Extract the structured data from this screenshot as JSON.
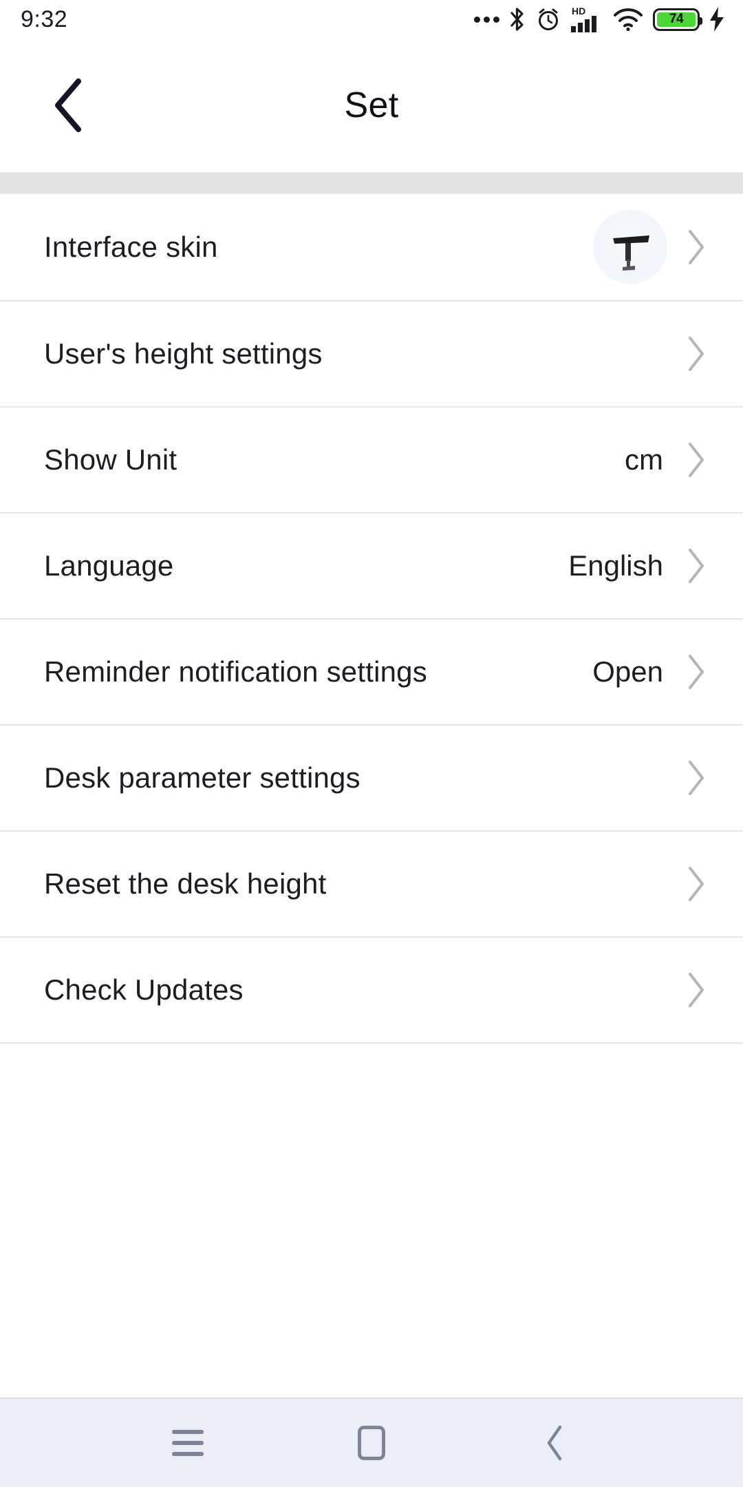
{
  "status_bar": {
    "time": "9:32",
    "icons": [
      {
        "name": "more-dots-icon"
      },
      {
        "name": "bluetooth-icon"
      },
      {
        "name": "alarm-clock-icon"
      },
      {
        "name": "hd-signal-icon",
        "label": "HD"
      },
      {
        "name": "wifi-icon"
      },
      {
        "name": "battery-icon"
      },
      {
        "name": "charging-bolt-icon"
      }
    ],
    "battery_level": "74",
    "battery_color": "#4cd637"
  },
  "header": {
    "title": "Set",
    "back_label": "Back"
  },
  "list": {
    "rows": [
      {
        "label": "Interface skin",
        "value": "",
        "thumbnail": "standing-desk-thumbnail",
        "chevron": "chevron-right-icon"
      },
      {
        "label": "User's height settings",
        "value": "",
        "thumbnail": "",
        "chevron": "chevron-right-icon"
      },
      {
        "label": "Show Unit",
        "value": "cm",
        "thumbnail": "",
        "chevron": "chevron-right-icon"
      },
      {
        "label": "Language",
        "value": "English",
        "thumbnail": "",
        "chevron": "chevron-right-icon"
      },
      {
        "label": "Reminder notification settings",
        "value": "Open",
        "thumbnail": "",
        "chevron": "chevron-right-icon"
      },
      {
        "label": "Desk parameter settings",
        "value": "",
        "thumbnail": "",
        "chevron": "chevron-right-icon"
      },
      {
        "label": "Reset the desk height",
        "value": "",
        "thumbnail": "",
        "chevron": "chevron-right-icon"
      },
      {
        "label": "Check Updates",
        "value": "",
        "thumbnail": "",
        "chevron": "chevron-right-icon"
      }
    ]
  },
  "nav_bar": {
    "buttons": [
      {
        "name": "recents-button",
        "icon": "hamburger-icon"
      },
      {
        "name": "home-button",
        "icon": "home-square-icon"
      },
      {
        "name": "back-button",
        "icon": "chevron-left-icon"
      }
    ],
    "background": "#ebedf7"
  }
}
